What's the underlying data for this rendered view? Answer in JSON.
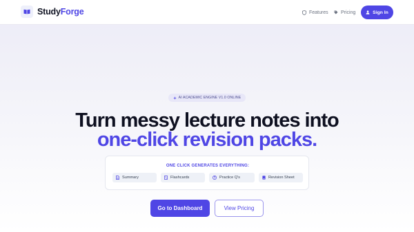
{
  "brand": {
    "part1": "Study",
    "part2": "Forge"
  },
  "nav": {
    "features_label": "Features",
    "pricing_label": "Pricing",
    "signin_label": "Sign In"
  },
  "hero": {
    "badge": "AI ACADEMIC ENGINE V1.0 ONLINE",
    "headline_line1": "Turn messy lecture notes into",
    "headline_line2": "one-click revision packs."
  },
  "generates": {
    "title": "ONE CLICK GENERATES EVERYTHING:",
    "items": [
      {
        "label": "Summary",
        "icon": "document-icon"
      },
      {
        "label": "Flashcards",
        "icon": "card-icon"
      },
      {
        "label": "Practice Q's",
        "icon": "question-icon"
      },
      {
        "label": "Revision Sheet",
        "icon": "book-icon"
      }
    ]
  },
  "cta": {
    "primary_label": "Go to Dashboard",
    "secondary_label": "View Pricing"
  },
  "colors": {
    "accent": "#4F46E5",
    "text_dark": "#0E1020",
    "muted": "#6B7280"
  }
}
